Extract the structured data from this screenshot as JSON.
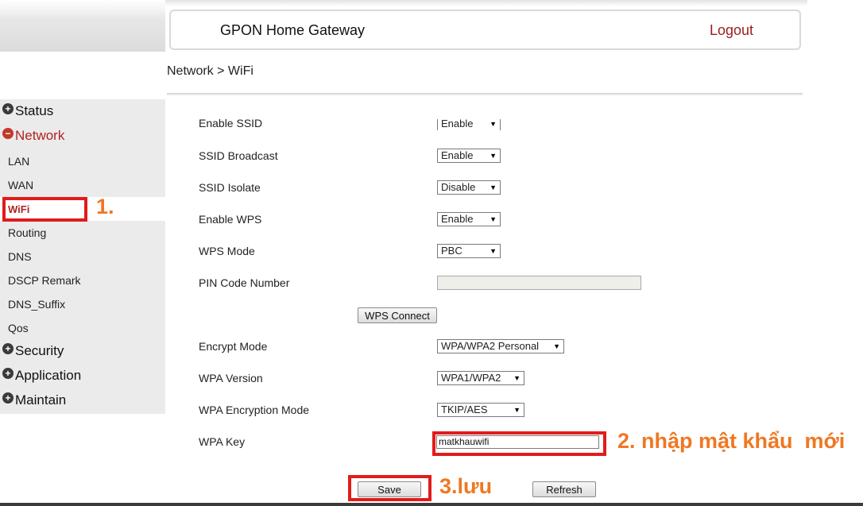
{
  "header": {
    "title": "GPON Home Gateway",
    "logout": "Logout"
  },
  "breadcrumb": "Network > WiFi",
  "sidebar": {
    "groups": [
      {
        "label": "Status",
        "symbol": "+"
      },
      {
        "label": "Network",
        "symbol": "−"
      },
      {
        "label": "Security",
        "symbol": "+"
      },
      {
        "label": "Application",
        "symbol": "+"
      },
      {
        "label": "Maintain",
        "symbol": "+"
      }
    ],
    "items": [
      "LAN",
      "WAN",
      "WiFi",
      "Routing",
      "DNS",
      "DSCP Remark",
      "DNS_Suffix",
      "Qos"
    ]
  },
  "form": {
    "enable_ssid": {
      "label": "Enable SSID",
      "value": "Enable"
    },
    "ssid_broadcast": {
      "label": "SSID Broadcast",
      "value": "Enable"
    },
    "ssid_isolate": {
      "label": "SSID Isolate",
      "value": "Disable"
    },
    "enable_wps": {
      "label": "Enable WPS",
      "value": "Enable"
    },
    "wps_mode": {
      "label": "WPS Mode",
      "value": "PBC"
    },
    "pin_code": {
      "label": "PIN Code Number",
      "value": ""
    },
    "wps_connect": "WPS Connect",
    "encrypt_mode": {
      "label": "Encrypt Mode",
      "value": "WPA/WPA2 Personal"
    },
    "wpa_version": {
      "label": "WPA Version",
      "value": "WPA1/WPA2"
    },
    "wpa_encryption": {
      "label": "WPA Encryption Mode",
      "value": "TKIP/AES"
    },
    "wpa_key": {
      "label": "WPA Key",
      "value": "matkhauwifi"
    },
    "save": "Save",
    "refresh": "Refresh"
  },
  "annotations": {
    "step1": "1.",
    "step2": "2. nhập mật khẩu  mới",
    "step3": "3.lưu"
  },
  "colors": {
    "annotation": "#f07722",
    "highlight_box": "#e21b1b",
    "active_nav": "#b22222"
  }
}
